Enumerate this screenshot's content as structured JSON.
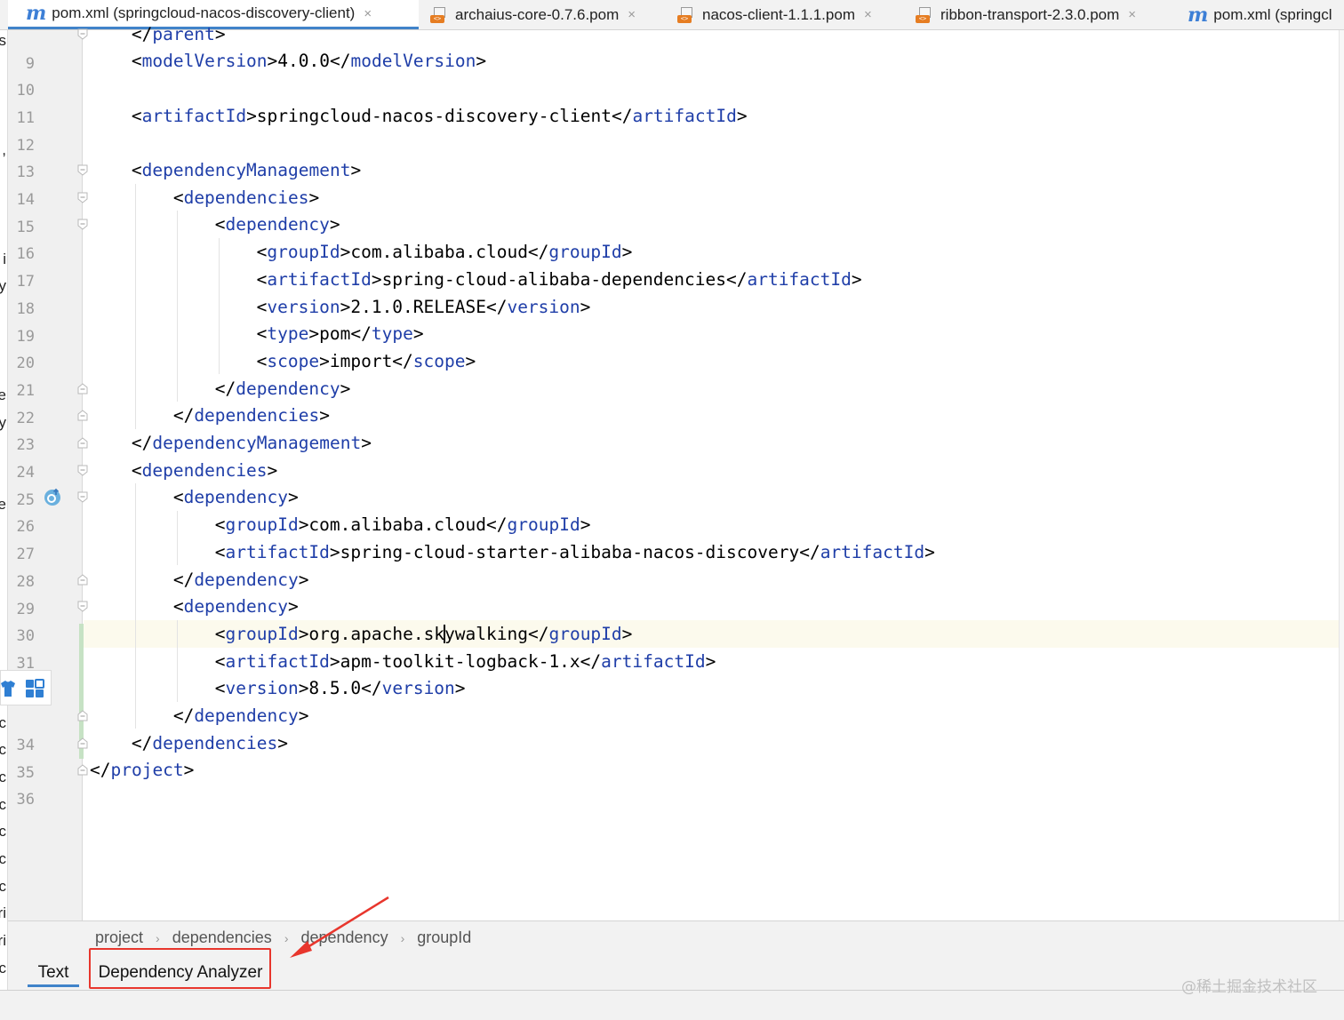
{
  "tabs": [
    {
      "label": "pom.xml (springcloud-nacos-discovery-client)",
      "icon": "maven-m-icon",
      "active": true,
      "close": "×"
    },
    {
      "label": "archaius-core-0.7.6.pom",
      "icon": "pom-file-icon",
      "active": false,
      "close": "×"
    },
    {
      "label": "nacos-client-1.1.1.pom",
      "icon": "pom-file-icon",
      "active": false,
      "close": "×"
    },
    {
      "label": "ribbon-transport-2.3.0.pom",
      "icon": "pom-file-icon",
      "active": false,
      "close": "×"
    },
    {
      "label": "pom.xml (springcl",
      "icon": "maven-m-icon",
      "active": false,
      "close": ""
    }
  ],
  "tab_icon_letters": {
    "maven": "m",
    "pom": "<>"
  },
  "left_strip_chars": [
    {
      "ch": "s",
      "row": 0
    },
    {
      "ch": ",",
      "row": 4
    },
    {
      "ch": "i",
      "row": 8
    },
    {
      "ch": "y",
      "row": 9
    },
    {
      "ch": "e",
      "row": 13
    },
    {
      "ch": "y",
      "row": 14
    },
    {
      "ch": "e",
      "row": 17
    },
    {
      "ch": "c",
      "row": 25
    },
    {
      "ch": "c",
      "row": 26
    },
    {
      "ch": "c",
      "row": 27
    },
    {
      "ch": "c",
      "row": 28
    },
    {
      "ch": "c",
      "row": 29
    },
    {
      "ch": "c",
      "row": 30
    },
    {
      "ch": "c",
      "row": 31
    },
    {
      "ch": "ri",
      "row": 32
    },
    {
      "ch": "ri",
      "row": 33
    },
    {
      "ch": "c",
      "row": 34
    },
    {
      "ch": "c",
      "row": 35
    }
  ],
  "code_lines": [
    {
      "n": "9",
      "indent": 1,
      "text": [
        {
          "t": "</"
        },
        {
          "t": "parent",
          "tag": true
        },
        {
          "t": ">"
        }
      ],
      "fold": "start"
    },
    {
      "n": "10",
      "indent": 1,
      "text": [
        {
          "t": "<"
        },
        {
          "t": "modelVersion",
          "tag": true
        },
        {
          "t": ">4.0.0</"
        },
        {
          "t": "modelVersion",
          "tag": true
        },
        {
          "t": ">"
        }
      ]
    },
    {
      "n": "11",
      "indent": 0,
      "text": []
    },
    {
      "n": "12",
      "indent": 1,
      "text": [
        {
          "t": "<"
        },
        {
          "t": "artifactId",
          "tag": true
        },
        {
          "t": ">springcloud-nacos-discovery-client</"
        },
        {
          "t": "artifactId",
          "tag": true
        },
        {
          "t": ">"
        }
      ]
    },
    {
      "n": "13",
      "indent": 0,
      "text": []
    },
    {
      "n": "14",
      "indent": 1,
      "text": [
        {
          "t": "<"
        },
        {
          "t": "dependencyManagement",
          "tag": true
        },
        {
          "t": ">"
        }
      ],
      "fold": "start"
    },
    {
      "n": "15",
      "indent": 2,
      "text": [
        {
          "t": "<"
        },
        {
          "t": "dependencies",
          "tag": true
        },
        {
          "t": ">"
        }
      ],
      "fold": "start"
    },
    {
      "n": "16",
      "indent": 3,
      "text": [
        {
          "t": "<"
        },
        {
          "t": "dependency",
          "tag": true
        },
        {
          "t": ">"
        }
      ],
      "fold": "start"
    },
    {
      "n": "17",
      "indent": 4,
      "text": [
        {
          "t": "<"
        },
        {
          "t": "groupId",
          "tag": true
        },
        {
          "t": ">com.alibaba.cloud</"
        },
        {
          "t": "groupId",
          "tag": true
        },
        {
          "t": ">"
        }
      ]
    },
    {
      "n": "18",
      "indent": 4,
      "text": [
        {
          "t": "<"
        },
        {
          "t": "artifactId",
          "tag": true
        },
        {
          "t": ">spring-cloud-alibaba-dependencies</"
        },
        {
          "t": "artifactId",
          "tag": true
        },
        {
          "t": ">"
        }
      ]
    },
    {
      "n": "19",
      "indent": 4,
      "text": [
        {
          "t": "<"
        },
        {
          "t": "version",
          "tag": true
        },
        {
          "t": ">2.1.0.RELEASE</"
        },
        {
          "t": "version",
          "tag": true
        },
        {
          "t": ">"
        }
      ]
    },
    {
      "n": "20",
      "indent": 4,
      "text": [
        {
          "t": "<"
        },
        {
          "t": "type",
          "tag": true
        },
        {
          "t": ">pom</"
        },
        {
          "t": "type",
          "tag": true
        },
        {
          "t": ">"
        }
      ]
    },
    {
      "n": "21",
      "indent": 4,
      "text": [
        {
          "t": "<"
        },
        {
          "t": "scope",
          "tag": true
        },
        {
          "t": ">import</"
        },
        {
          "t": "scope",
          "tag": true
        },
        {
          "t": ">"
        }
      ]
    },
    {
      "n": "22",
      "indent": 3,
      "text": [
        {
          "t": "</"
        },
        {
          "t": "dependency",
          "tag": true
        },
        {
          "t": ">"
        }
      ],
      "fold": "end"
    },
    {
      "n": "23",
      "indent": 2,
      "text": [
        {
          "t": "</"
        },
        {
          "t": "dependencies",
          "tag": true
        },
        {
          "t": ">"
        }
      ],
      "fold": "end"
    },
    {
      "n": "24",
      "indent": 1,
      "text": [
        {
          "t": "</"
        },
        {
          "t": "dependencyManagement",
          "tag": true
        },
        {
          "t": ">"
        }
      ],
      "fold": "end"
    },
    {
      "n": "25",
      "indent": 1,
      "text": [
        {
          "t": "<"
        },
        {
          "t": "dependencies",
          "tag": true
        },
        {
          "t": ">"
        }
      ],
      "fold": "start"
    },
    {
      "n": "26",
      "indent": 2,
      "text": [
        {
          "t": "<"
        },
        {
          "t": "dependency",
          "tag": true
        },
        {
          "t": ">"
        }
      ],
      "fold": "start",
      "marker": "override"
    },
    {
      "n": "27",
      "indent": 3,
      "text": [
        {
          "t": "<"
        },
        {
          "t": "groupId",
          "tag": true
        },
        {
          "t": ">com.alibaba.cloud</"
        },
        {
          "t": "groupId",
          "tag": true
        },
        {
          "t": ">"
        }
      ]
    },
    {
      "n": "28",
      "indent": 3,
      "text": [
        {
          "t": "<"
        },
        {
          "t": "artifactId",
          "tag": true
        },
        {
          "t": ">spring-cloud-starter-alibaba-nacos-discovery</"
        },
        {
          "t": "artifactId",
          "tag": true
        },
        {
          "t": ">"
        }
      ]
    },
    {
      "n": "29",
      "indent": 2,
      "text": [
        {
          "t": "</"
        },
        {
          "t": "dependency",
          "tag": true
        },
        {
          "t": ">"
        }
      ],
      "fold": "end"
    },
    {
      "n": "30",
      "indent": 2,
      "text": [
        {
          "t": "<"
        },
        {
          "t": "dependency",
          "tag": true
        },
        {
          "t": ">"
        }
      ],
      "fold": "start"
    },
    {
      "n": "31",
      "indent": 3,
      "text": [
        {
          "t": "<"
        },
        {
          "t": "groupId",
          "tag": true
        },
        {
          "t": ">org.apache.sk"
        },
        {
          "caret": true
        },
        {
          "t": "ywalking</"
        },
        {
          "t": "groupId",
          "tag": true
        },
        {
          "t": ">"
        }
      ],
      "current": true
    },
    {
      "n": "32",
      "indent": 3,
      "text": [
        {
          "t": "<"
        },
        {
          "t": "artifactId",
          "tag": true
        },
        {
          "t": ">apm-toolkit-logback-1.x</"
        },
        {
          "t": "artifactId",
          "tag": true
        },
        {
          "t": ">"
        }
      ]
    },
    {
      "n": "",
      "indent": 3,
      "text": [
        {
          "t": "<"
        },
        {
          "t": "version",
          "tag": true
        },
        {
          "t": ">8.5.0</"
        },
        {
          "t": "version",
          "tag": true
        },
        {
          "t": ">"
        }
      ]
    },
    {
      "n": "34",
      "indent": 2,
      "text": [
        {
          "t": "</"
        },
        {
          "t": "dependency",
          "tag": true
        },
        {
          "t": ">"
        }
      ],
      "fold": "end"
    },
    {
      "n": "35",
      "indent": 1,
      "text": [
        {
          "t": "</"
        },
        {
          "t": "dependencies",
          "tag": true
        },
        {
          "t": ">"
        }
      ],
      "fold": "end"
    },
    {
      "n": "36",
      "indent": 0,
      "text": [
        {
          "t": "</"
        },
        {
          "t": "project",
          "tag": true
        },
        {
          "t": ">"
        }
      ],
      "fold": "end"
    }
  ],
  "breadcrumb": [
    "project",
    "dependencies",
    "dependency",
    "groupId"
  ],
  "breadcrumb_sep": "›",
  "view_tabs": {
    "text": "Text",
    "analyzer": "Dependency Analyzer"
  },
  "watermark": "@稀土掘金技术社区",
  "colors": {
    "tag": "#1f3ea8",
    "annotation": "#e8362d",
    "active_tab": "#4083c9",
    "maven_icon": "#3d7fd6",
    "pom_icon": "#e67d22"
  }
}
